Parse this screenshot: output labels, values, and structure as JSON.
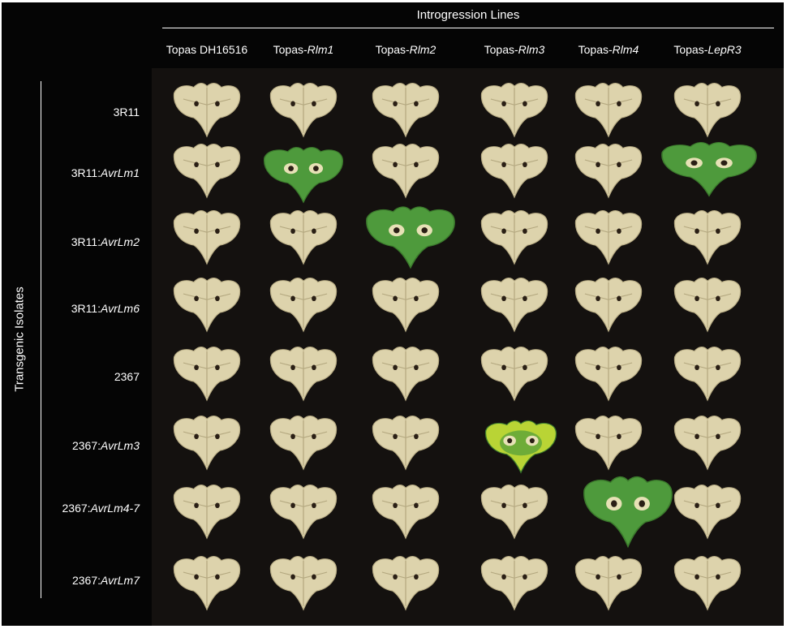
{
  "header": {
    "title": "Introgression Lines"
  },
  "side": {
    "title": "Transgenic Isolates"
  },
  "columns": [
    {
      "base": "Topas DH16516",
      "gene": ""
    },
    {
      "base": "Topas-",
      "gene": "Rlm1"
    },
    {
      "base": "Topas-",
      "gene": "Rlm2"
    },
    {
      "base": "Topas-",
      "gene": "Rlm3"
    },
    {
      "base": "Topas-",
      "gene": "Rlm4"
    },
    {
      "base": "Topas-",
      "gene": "LepR3"
    }
  ],
  "rows": [
    {
      "base": "3R11",
      "gene": ""
    },
    {
      "base": "3R11:",
      "gene": "AvrLm1"
    },
    {
      "base": "3R11:",
      "gene": "AvrLm2"
    },
    {
      "base": "3R11:",
      "gene": "AvrLm6"
    },
    {
      "base": "2367",
      "gene": ""
    },
    {
      "base": "2367:",
      "gene": "AvrLm3"
    },
    {
      "base": "2367:",
      "gene": "AvrLm4-7"
    },
    {
      "base": "2367:",
      "gene": "AvrLm7"
    }
  ],
  "colors": {
    "frame": "#050505",
    "background_cloth": "#14110f",
    "necrotic_leaf": "#ddd3ac",
    "necrotic_leaf_edge": "#b9ad85",
    "healthy_leaf": "#4e9a3c",
    "chlorotic_leaf": "#b9d435",
    "lesion": "#2a1f15"
  },
  "leaves": [
    [
      "necrotic",
      "necrotic",
      "necrotic",
      "necrotic",
      "necrotic",
      "necrotic"
    ],
    [
      "necrotic",
      "green",
      "necrotic",
      "necrotic",
      "necrotic",
      "green"
    ],
    [
      "necrotic",
      "necrotic",
      "green",
      "necrotic",
      "necrotic",
      "necrotic"
    ],
    [
      "necrotic",
      "necrotic",
      "necrotic",
      "necrotic",
      "necrotic",
      "necrotic"
    ],
    [
      "necrotic",
      "necrotic",
      "necrotic",
      "necrotic",
      "necrotic",
      "necrotic"
    ],
    [
      "necrotic",
      "necrotic",
      "necrotic",
      "chlorotic",
      "necrotic",
      "necrotic"
    ],
    [
      "necrotic",
      "necrotic",
      "necrotic",
      "necrotic",
      "green",
      "necrotic"
    ],
    [
      "necrotic",
      "necrotic",
      "necrotic",
      "necrotic",
      "necrotic",
      "necrotic"
    ]
  ]
}
